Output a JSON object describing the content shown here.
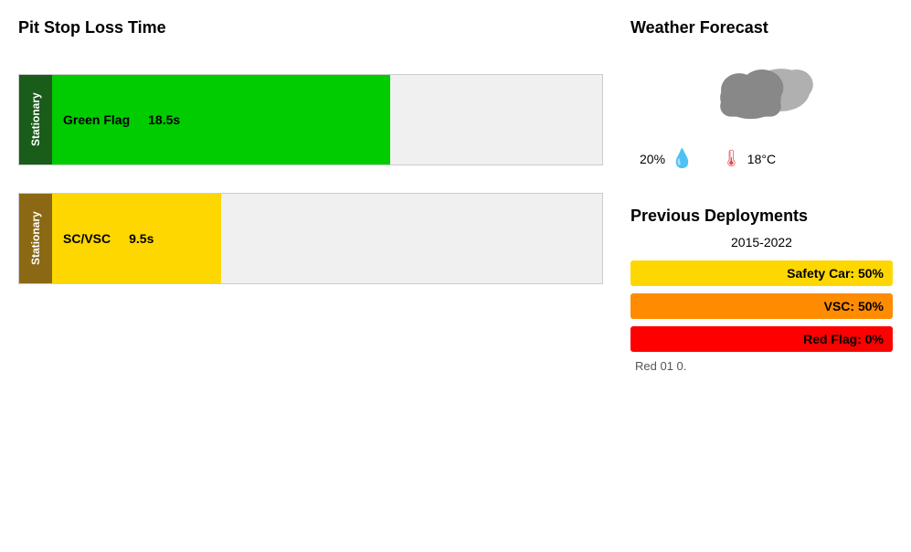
{
  "left": {
    "title": "Pit Stop Loss Time",
    "bars": [
      {
        "label": "Stationary",
        "label_bg": "green-bg",
        "fill_class": "green",
        "flag_type": "Green Flag",
        "time": "18.5s"
      },
      {
        "label": "Stationary",
        "label_bg": "yellow-bg",
        "fill_class": "yellow",
        "flag_type": "SC/VSC",
        "time": "9.5s"
      }
    ]
  },
  "right": {
    "weather": {
      "title": "Weather Forecast",
      "rain_pct": "20%",
      "temperature": "18°C"
    },
    "deployments": {
      "title": "Previous Deployments",
      "year_range": "2015-2022",
      "items": [
        {
          "label": "Safety Car:",
          "pct": "50%",
          "class": "safety-car"
        },
        {
          "label": "VSC:",
          "pct": "50%",
          "class": "vsc"
        },
        {
          "label": "Red Flag:",
          "pct": "0%",
          "class": "red-flag"
        }
      ]
    },
    "red_note": "Red 01 0."
  }
}
